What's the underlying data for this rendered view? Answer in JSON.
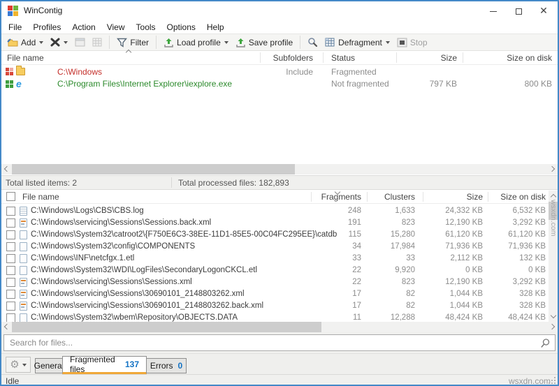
{
  "window": {
    "title": "WinContig",
    "accent_border_color": "#4489c8",
    "tab_accent_color": "#f0a838",
    "count_color": "#1272c4"
  },
  "menu": {
    "items": [
      "File",
      "Profiles",
      "Action",
      "View",
      "Tools",
      "Options",
      "Help"
    ]
  },
  "toolbar": {
    "add": "Add",
    "filter": "Filter",
    "load_profile": "Load profile",
    "save_profile": "Save profile",
    "defragment": "Defragment",
    "stop": "Stop"
  },
  "top_list": {
    "columns": {
      "name": "File name",
      "subfolders": "Subfolders",
      "status": "Status",
      "size": "Size",
      "size_on_disk": "Size on disk"
    },
    "rows": [
      {
        "name": "C:\\Windows",
        "subfolders": "Include",
        "status": "Fragmented",
        "size": "",
        "size_on_disk": "",
        "name_color": "#c4302b"
      },
      {
        "name": "C:\\Program Files\\Internet Explorer\\iexplore.exe",
        "subfolders": "",
        "status": "Not fragmented",
        "size": "797 KB",
        "size_on_disk": "800 KB",
        "name_color": "#2c8a2c"
      }
    ]
  },
  "totals": {
    "listed": "Total listed items: 2",
    "processed": "Total processed files: 182,893"
  },
  "bottom_list": {
    "columns": {
      "name": "File name",
      "fragments": "Fragments",
      "clusters": "Clusters",
      "size": "Size",
      "size_on_disk": "Size on disk"
    },
    "rows": [
      {
        "name": "C:\\Windows\\Logs\\CBS\\CBS.log",
        "fragments": "248",
        "clusters": "1,633",
        "size": "24,332 KB",
        "size_on_disk": "6,532 KB",
        "icon": "log-file"
      },
      {
        "name": "C:\\Windows\\servicing\\Sessions\\Sessions.back.xml",
        "fragments": "191",
        "clusters": "823",
        "size": "12,190 KB",
        "size_on_disk": "3,292 KB",
        "icon": "xml-file"
      },
      {
        "name": "C:\\Windows\\System32\\catroot2\\{F750E6C3-38EE-11D1-85E5-00C04FC295EE}\\catdb",
        "fragments": "115",
        "clusters": "15,280",
        "size": "61,120 KB",
        "size_on_disk": "61,120 KB",
        "icon": "plain-file"
      },
      {
        "name": "C:\\Windows\\System32\\config\\COMPONENTS",
        "fragments": "34",
        "clusters": "17,984",
        "size": "71,936 KB",
        "size_on_disk": "71,936 KB",
        "icon": "plain-file"
      },
      {
        "name": "C:\\Windows\\INF\\netcfgx.1.etl",
        "fragments": "33",
        "clusters": "33",
        "size": "2,112 KB",
        "size_on_disk": "132 KB",
        "icon": "plain-file"
      },
      {
        "name": "C:\\Windows\\System32\\WDI\\LogFiles\\SecondaryLogonCKCL.etl",
        "fragments": "22",
        "clusters": "9,920",
        "size": "0 KB",
        "size_on_disk": "0 KB",
        "icon": "plain-file"
      },
      {
        "name": "C:\\Windows\\servicing\\Sessions\\Sessions.xml",
        "fragments": "22",
        "clusters": "823",
        "size": "12,190 KB",
        "size_on_disk": "3,292 KB",
        "icon": "xml-file"
      },
      {
        "name": "C:\\Windows\\servicing\\Sessions\\30690101_2148803262.xml",
        "fragments": "17",
        "clusters": "82",
        "size": "1,044 KB",
        "size_on_disk": "328 KB",
        "icon": "xml-file"
      },
      {
        "name": "C:\\Windows\\servicing\\Sessions\\30690101_2148803262.back.xml",
        "fragments": "17",
        "clusters": "82",
        "size": "1,044 KB",
        "size_on_disk": "328 KB",
        "icon": "xml-file"
      },
      {
        "name": "C:\\Windows\\System32\\wbem\\Repository\\OBJECTS.DATA",
        "fragments": "11",
        "clusters": "12,288",
        "size": "48,424 KB",
        "size_on_disk": "48,424 KB",
        "icon": "plain-file"
      }
    ]
  },
  "search": {
    "placeholder": "Search for files..."
  },
  "tabs": {
    "general": "General",
    "fragmented": "Fragmented files",
    "fragmented_count": "137",
    "errors": "Errors",
    "errors_count": "0"
  },
  "status_bar": {
    "text": "Idle"
  },
  "watermark": {
    "text": "wsxdn.com"
  }
}
